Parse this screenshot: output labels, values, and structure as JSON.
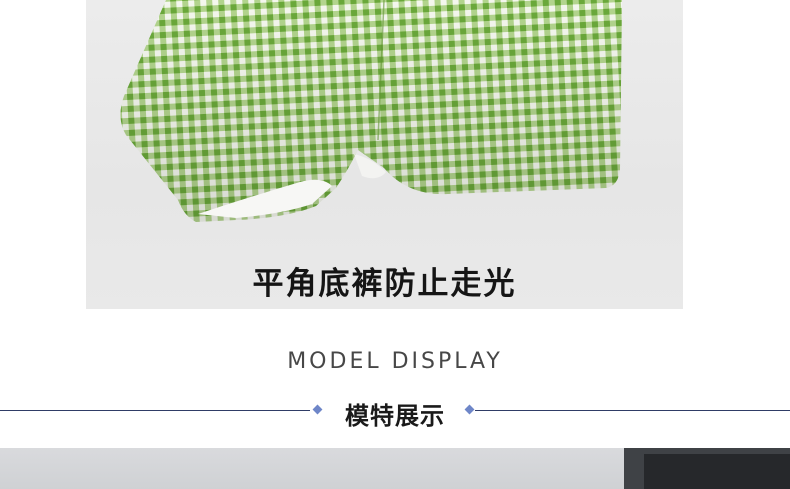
{
  "photo": {
    "caption": "平角底裤防止走光"
  },
  "section": {
    "title_en": "MODEL DISPLAY",
    "title_cn": "模特展示"
  },
  "colors": {
    "gingham_green": "#7ab648",
    "gingham_white": "#f4f7ee",
    "divider": "#2f3c66",
    "diamond": "#6e86c8"
  }
}
